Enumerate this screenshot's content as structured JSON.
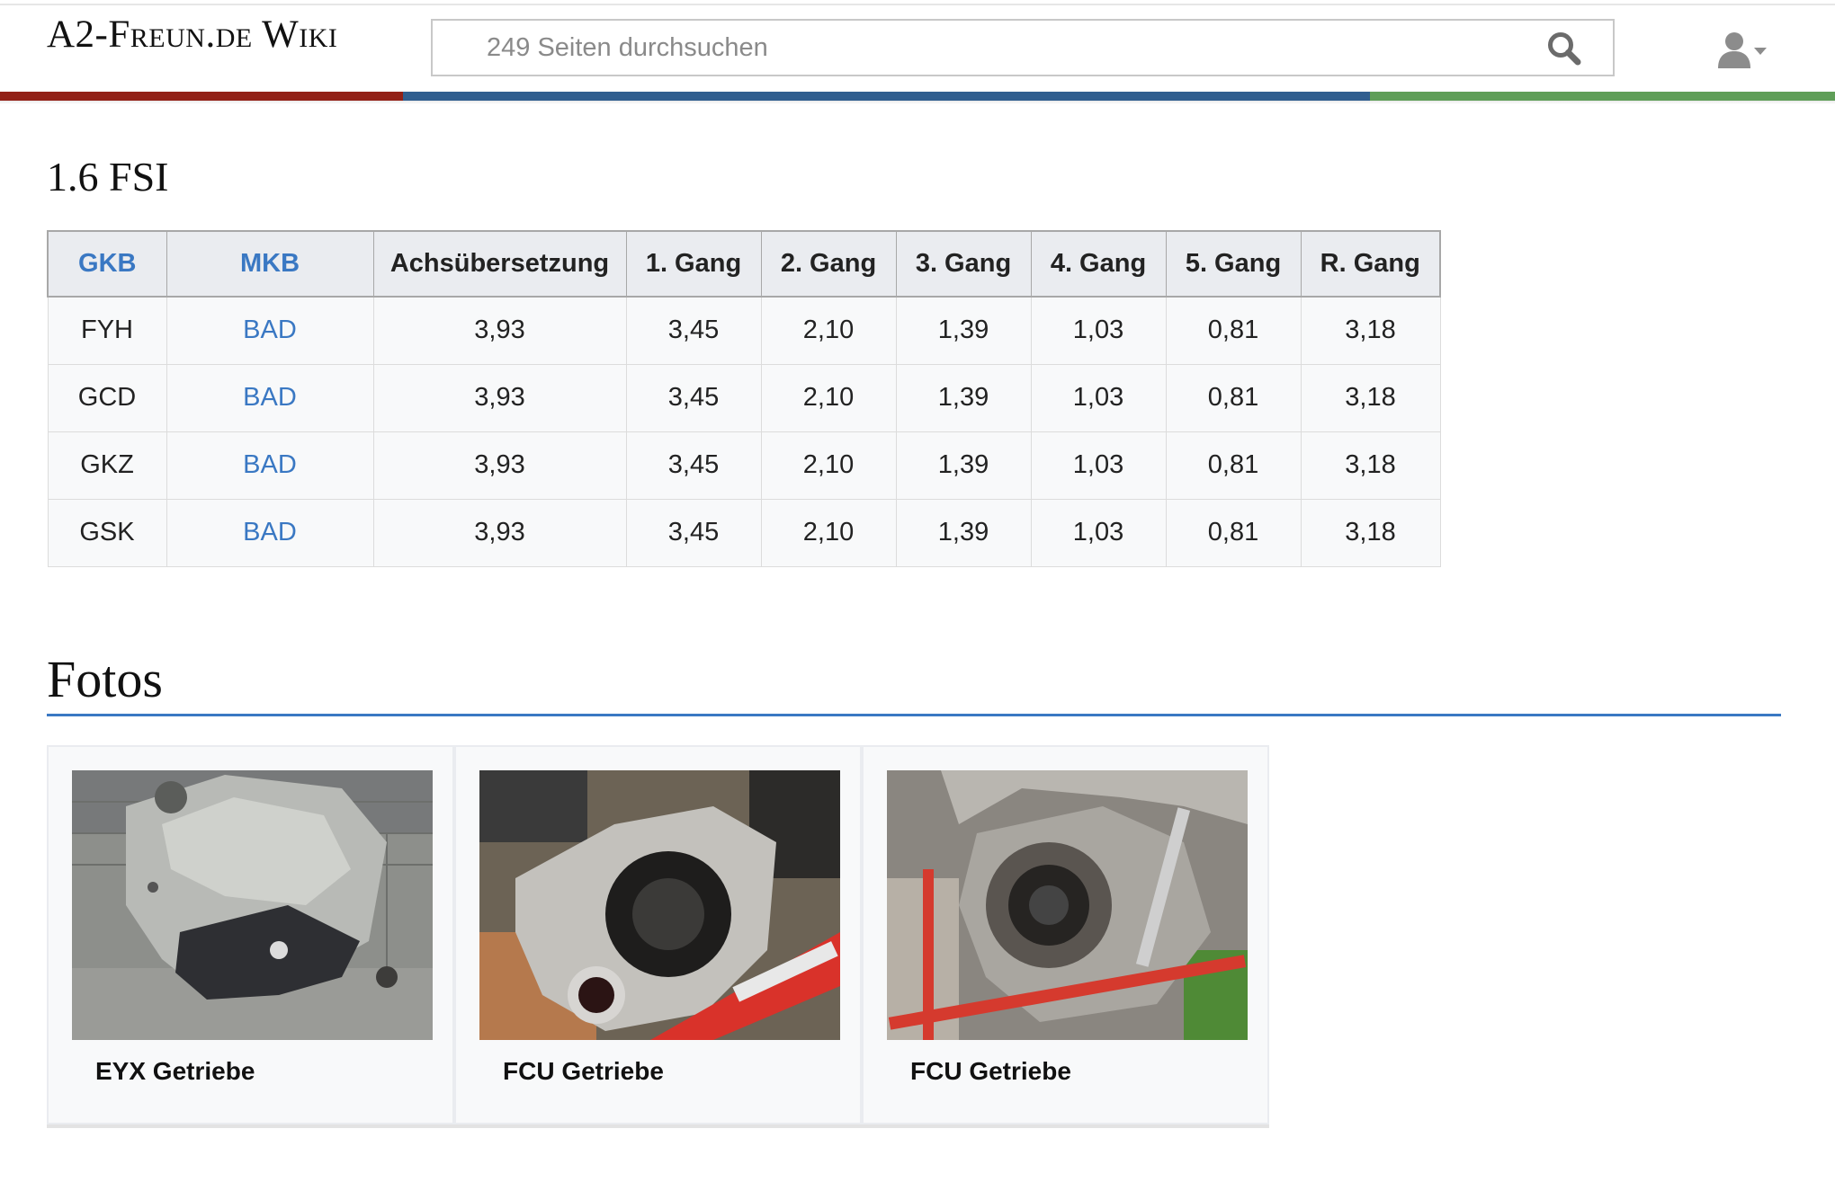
{
  "header": {
    "logo": "A2-Freun.de Wiki",
    "search": {
      "placeholder": "249 Seiten durchsuchen",
      "value": ""
    },
    "icons": {
      "search": "search-icon",
      "user": "user-icon",
      "dropdown": "caret-down-icon"
    },
    "bar_colors": [
      "#922117",
      "#305e8f",
      "#5f9e58"
    ]
  },
  "section_fsi": {
    "heading": "1.6 FSI",
    "table": {
      "columns": [
        "GKB",
        "MKB",
        "Achsübersetzung",
        "1. Gang",
        "2. Gang",
        "3. Gang",
        "4. Gang",
        "5. Gang",
        "R. Gang"
      ],
      "rows": [
        [
          "FYH",
          "BAD",
          "3,93",
          "3,45",
          "2,10",
          "1,39",
          "1,03",
          "0,81",
          "3,18"
        ],
        [
          "GCD",
          "BAD",
          "3,93",
          "3,45",
          "2,10",
          "1,39",
          "1,03",
          "0,81",
          "3,18"
        ],
        [
          "GKZ",
          "BAD",
          "3,93",
          "3,45",
          "2,10",
          "1,39",
          "1,03",
          "0,81",
          "3,18"
        ],
        [
          "GSK",
          "BAD",
          "3,93",
          "3,45",
          "2,10",
          "1,39",
          "1,03",
          "0,81",
          "3,18"
        ]
      ]
    }
  },
  "section_fotos": {
    "heading": "Fotos",
    "rule_color": "#3a78c3",
    "gallery": [
      {
        "caption": "EYX Getriebe"
      },
      {
        "caption": "FCU Getriebe"
      },
      {
        "caption": "FCU Getriebe"
      }
    ]
  },
  "colors": {
    "link": "#3a78c3",
    "header_cell": "#eaecf0",
    "body_cell": "#f8f9fa"
  }
}
